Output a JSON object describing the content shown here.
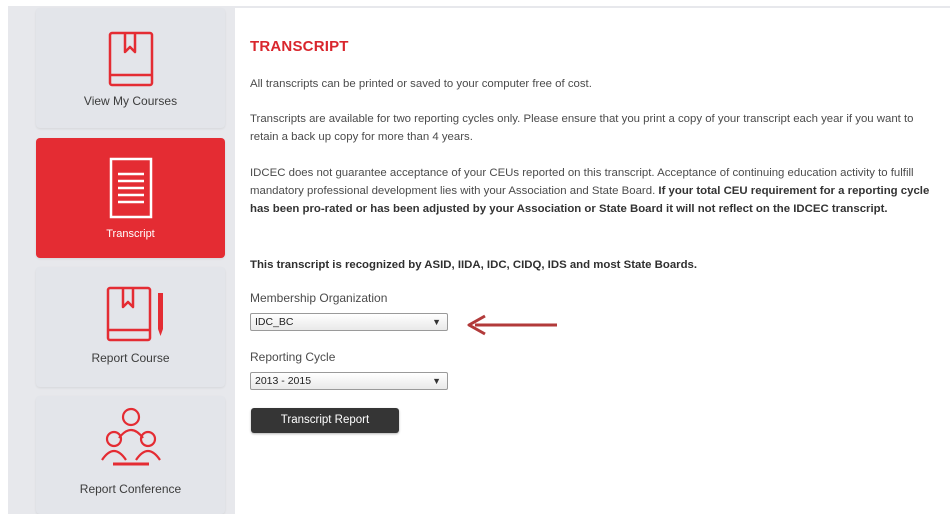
{
  "sidebar": {
    "items": [
      {
        "label": "View My Courses",
        "icon": "book-icon"
      },
      {
        "label": "Transcript",
        "icon": "document-icon",
        "active": true
      },
      {
        "label": "Report Course",
        "icon": "book-pencil-icon"
      },
      {
        "label": "Report Conference",
        "icon": "people-icon"
      }
    ]
  },
  "main": {
    "title": "TRANSCRIPT",
    "p1": "All transcripts can be printed or saved to your computer free of cost.",
    "p2": "Transcripts are available for two reporting cycles only. Please ensure that you print a copy of your transcript each year if you want to retain a back up copy for more than 4 years.",
    "p3_normal": "IDCEC does not guarantee acceptance of your CEUs reported on this transcript. Acceptance of continuing education activity to fulfill mandatory professional development lies with your Association and State Board. ",
    "p3_bold": "If your total CEU requirement for a reporting cycle has been pro-rated or has been adjusted by your Association or State Board it will not reflect on the IDCEC transcript.",
    "recognized": "This transcript is recognized by ASID, IIDA, IDC, CIDQ, IDS and most State Boards.",
    "membership_label": "Membership Organization",
    "membership_value": "IDC_BC",
    "cycle_label": "Reporting Cycle",
    "cycle_value": "2013 - 2015",
    "button_label": "Transcript Report"
  },
  "colors": {
    "accent": "#e42c33",
    "title": "#d9262d",
    "arrow": "#b23a3a",
    "button": "#353535"
  }
}
